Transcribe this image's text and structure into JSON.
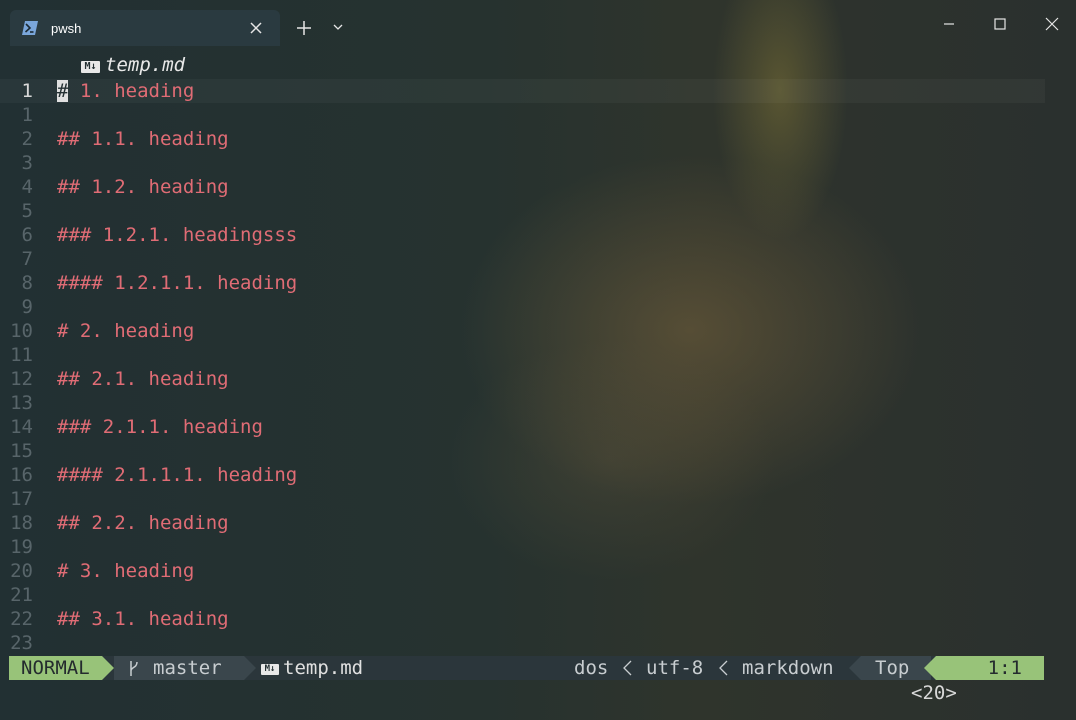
{
  "window": {
    "tab_title": "pwsh",
    "tab_icon": "powershell-icon",
    "controls": [
      "minimize-icon",
      "maximize-icon",
      "close-icon"
    ]
  },
  "editor": {
    "filename": "temp.md",
    "file_icon_text": "M↓",
    "current_line": 1,
    "lines": [
      {
        "num": "1",
        "text": "# 1. heading",
        "current": true
      },
      {
        "num": "1",
        "text": ""
      },
      {
        "num": "2",
        "text": "## 1.1. heading"
      },
      {
        "num": "3",
        "text": ""
      },
      {
        "num": "4",
        "text": "## 1.2. heading"
      },
      {
        "num": "5",
        "text": ""
      },
      {
        "num": "6",
        "text": "### 1.2.1. headingsss"
      },
      {
        "num": "7",
        "text": ""
      },
      {
        "num": "8",
        "text": "#### 1.2.1.1. heading"
      },
      {
        "num": "9",
        "text": ""
      },
      {
        "num": "10",
        "text": "# 2. heading"
      },
      {
        "num": "11",
        "text": ""
      },
      {
        "num": "12",
        "text": "## 2.1. heading"
      },
      {
        "num": "13",
        "text": ""
      },
      {
        "num": "14",
        "text": "### 2.1.1. heading"
      },
      {
        "num": "15",
        "text": ""
      },
      {
        "num": "16",
        "text": "#### 2.1.1.1. heading"
      },
      {
        "num": "17",
        "text": ""
      },
      {
        "num": "18",
        "text": "## 2.2. heading"
      },
      {
        "num": "19",
        "text": ""
      },
      {
        "num": "20",
        "text": "# 3. heading"
      },
      {
        "num": "21",
        "text": ""
      },
      {
        "num": "22",
        "text": "## 3.1. heading"
      },
      {
        "num": "23",
        "text": ""
      }
    ]
  },
  "statusline": {
    "mode": "NORMAL",
    "branch": "master",
    "file": "temp.md",
    "fileformat": "dos",
    "encoding": "utf-8",
    "filetype": "markdown",
    "scroll": "Top",
    "position": "1:1"
  },
  "cmdline": "<20>",
  "colors": {
    "heading": "#e06c75",
    "mode_bg": "#98c379",
    "line_number": "#58656a",
    "statusline_bg": "#2b363b"
  }
}
